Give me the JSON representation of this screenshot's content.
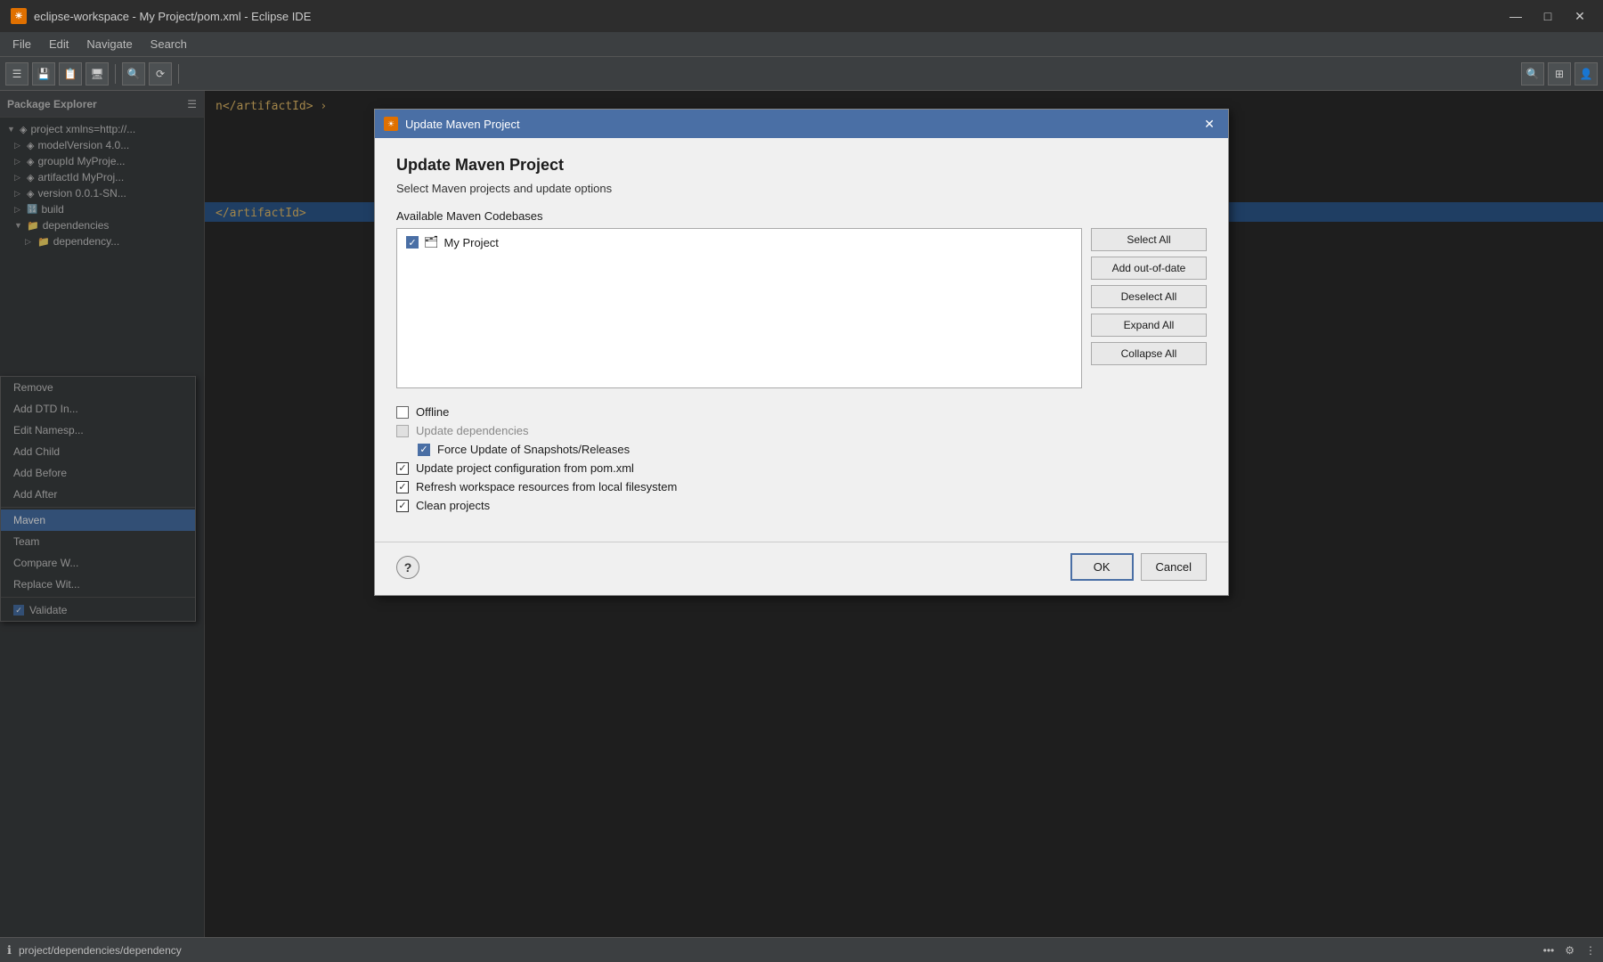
{
  "window": {
    "title": "eclipse-workspace - My Project/pom.xml - Eclipse IDE",
    "title_icon": "☀",
    "min_btn": "—",
    "max_btn": "□",
    "close_btn": "✕"
  },
  "menu": {
    "items": [
      "File",
      "Edit",
      "Navigate",
      "Search"
    ]
  },
  "panel": {
    "title": "Package Explorer",
    "tree": [
      {
        "label": "project xmlns=http://...",
        "level": 0,
        "arrow": "▼",
        "icon": "📄"
      },
      {
        "label": "modelVersion  4.0...",
        "level": 1,
        "arrow": "▷",
        "icon": "📄"
      },
      {
        "label": "groupId  MyProje...",
        "level": 1,
        "arrow": "▷",
        "icon": "📄"
      },
      {
        "label": "artifactId  MyProj...",
        "level": 1,
        "arrow": "▷",
        "icon": "📄"
      },
      {
        "label": "version  0.0.1-SN...",
        "level": 1,
        "arrow": "▷",
        "icon": "📄"
      },
      {
        "label": "build",
        "level": 1,
        "arrow": "▷",
        "icon": "🔢"
      },
      {
        "label": "dependencies",
        "level": 1,
        "arrow": "▼",
        "icon": "📁"
      },
      {
        "label": "dependency...",
        "level": 2,
        "arrow": "▷",
        "icon": "📁"
      }
    ]
  },
  "context_menu": {
    "items": [
      {
        "label": "Remove",
        "checked": false,
        "has_cb": false
      },
      {
        "label": "Add DTD In...",
        "checked": false,
        "has_cb": false
      },
      {
        "label": "Edit Namesp...",
        "checked": false,
        "has_cb": false
      },
      {
        "label": "Add Child",
        "checked": false,
        "has_cb": false
      },
      {
        "label": "Add Before",
        "checked": false,
        "has_cb": false
      },
      {
        "label": "Add After",
        "checked": false,
        "has_cb": false
      },
      {
        "label": "Maven",
        "checked": false,
        "has_cb": false,
        "selected": true
      },
      {
        "label": "Team",
        "checked": false,
        "has_cb": false
      },
      {
        "label": "Compare W...",
        "checked": false,
        "has_cb": false
      },
      {
        "label": "Replace Wit...",
        "checked": false,
        "has_cb": false
      },
      {
        "label": "Validate",
        "checked": true,
        "has_cb": true
      }
    ]
  },
  "dialog": {
    "title": "Update Maven Project",
    "title_icon": "☀",
    "close_btn": "✕",
    "main_title": "Update Maven Project",
    "subtitle": "Select Maven projects and update options",
    "section_label": "Available Maven Codebases",
    "codebase_items": [
      {
        "label": "My Project",
        "checked": true
      }
    ],
    "buttons": {
      "select_all": "Select All",
      "add_out_of_date": "Add out-of-date",
      "deselect_all": "Deselect All",
      "expand_all": "Expand All",
      "collapse_all": "Collapse All"
    },
    "options": [
      {
        "label": "Offline",
        "checked": false,
        "disabled": false,
        "blue": false,
        "indented": false
      },
      {
        "label": "Update dependencies",
        "checked": false,
        "disabled": true,
        "blue": false,
        "indented": false
      },
      {
        "label": "Force Update of Snapshots/Releases",
        "checked": true,
        "disabled": false,
        "blue": true,
        "indented": true
      },
      {
        "label": "Update project configuration from pom.xml",
        "checked": true,
        "disabled": false,
        "blue": false,
        "indented": false
      },
      {
        "label": "Refresh workspace resources from local filesystem",
        "checked": true,
        "disabled": false,
        "blue": false,
        "indented": false
      },
      {
        "label": "Clean projects",
        "checked": true,
        "disabled": false,
        "blue": false,
        "indented": false
      }
    ],
    "footer": {
      "help": "?",
      "ok": "OK",
      "cancel": "Cancel"
    }
  },
  "status_bar": {
    "left_icon": "ℹ",
    "left_text": "project/dependencies/dependency",
    "right_items": [
      "•••",
      "⚙",
      "⋮"
    ]
  }
}
